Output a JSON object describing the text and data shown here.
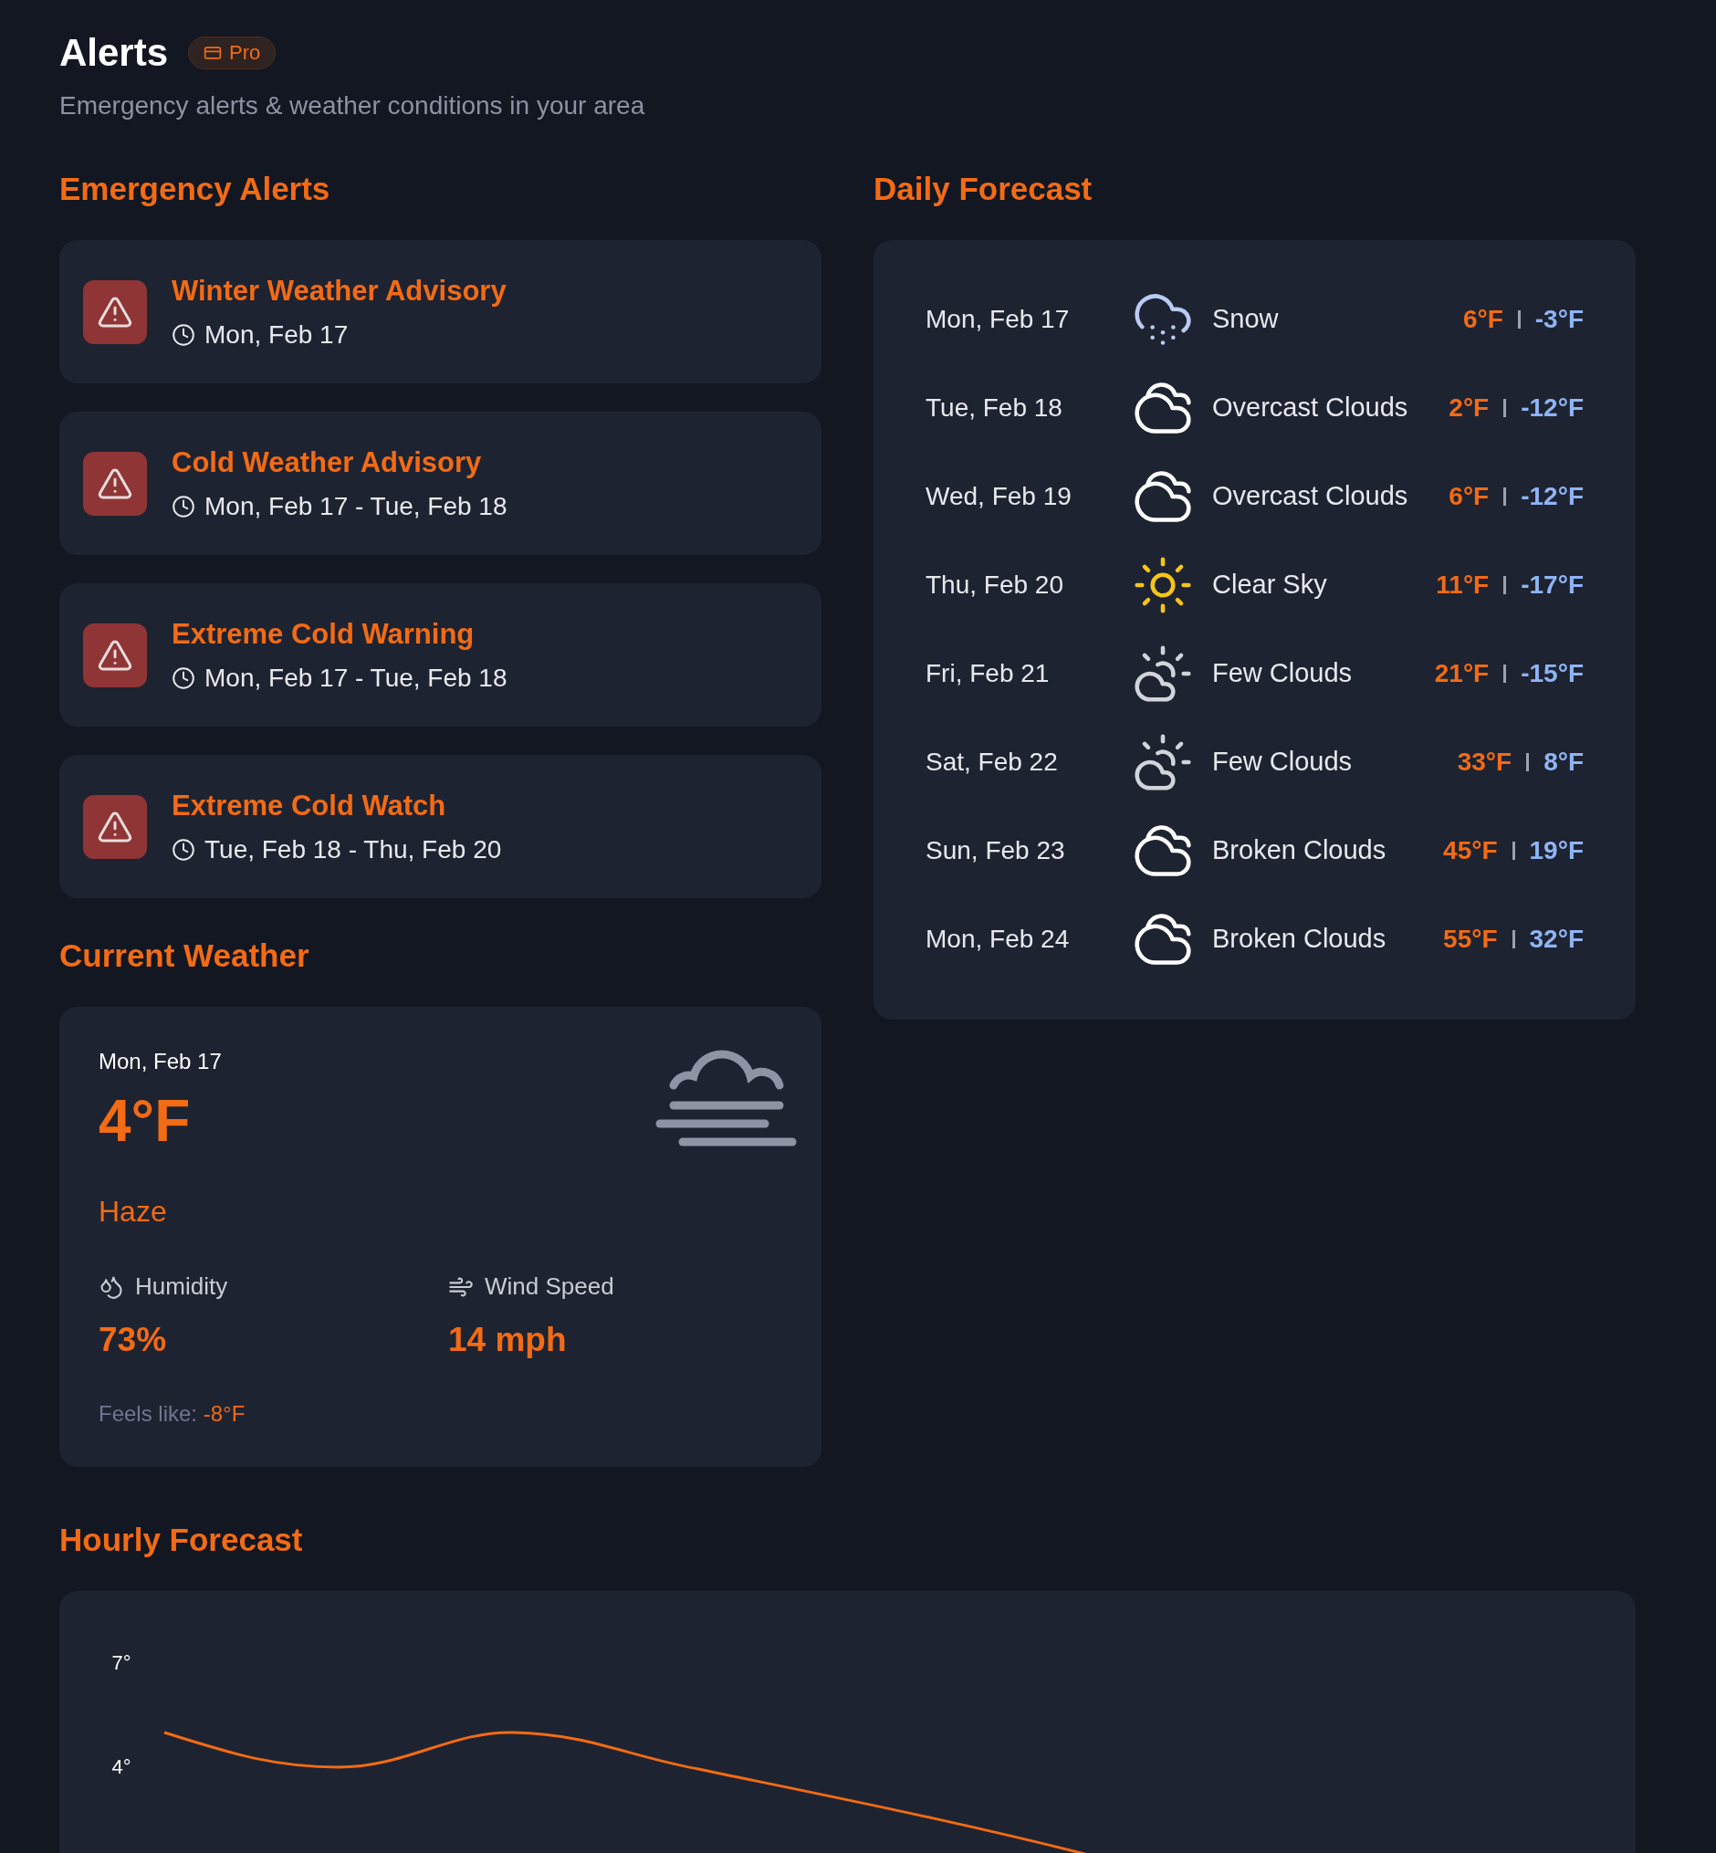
{
  "header": {
    "title": "Alerts",
    "badge": "Pro",
    "subtitle": "Emergency alerts & weather conditions in your area"
  },
  "emergency_alerts": {
    "title": "Emergency Alerts",
    "alerts": [
      {
        "title": "Winter Weather Advisory",
        "time": "Mon, Feb 17"
      },
      {
        "title": "Cold Weather Advisory",
        "time": "Mon, Feb 17 - Tue, Feb 18"
      },
      {
        "title": "Extreme Cold Warning",
        "time": "Mon, Feb 17 - Tue, Feb 18"
      },
      {
        "title": "Extreme Cold Watch",
        "time": "Tue, Feb 18 - Thu, Feb 20"
      }
    ]
  },
  "current_weather": {
    "title": "Current Weather",
    "date": "Mon, Feb 17",
    "temperature": "4°F",
    "condition": "Haze",
    "kind": "haze",
    "humidity": {
      "label": "Humidity",
      "value": "73%"
    },
    "wind_speed": {
      "label": "Wind Speed",
      "value": "14 mph"
    },
    "feels_like": {
      "label": "Feels like:",
      "value": "-8°F"
    }
  },
  "daily_forecast": {
    "title": "Daily Forecast",
    "days": [
      {
        "date": "Mon, Feb 17",
        "kind": "snow",
        "description": "Snow",
        "high": "6°F",
        "low": "-3°F"
      },
      {
        "date": "Tue, Feb 18",
        "kind": "clouds",
        "description": "Overcast Clouds",
        "high": "2°F",
        "low": "-12°F"
      },
      {
        "date": "Wed, Feb 19",
        "kind": "clouds",
        "description": "Overcast Clouds",
        "high": "6°F",
        "low": "-12°F"
      },
      {
        "date": "Thu, Feb 20",
        "kind": "clear",
        "description": "Clear Sky",
        "high": "11°F",
        "low": "-17°F"
      },
      {
        "date": "Fri, Feb 21",
        "kind": "few_clouds",
        "description": "Few Clouds",
        "high": "21°F",
        "low": "-15°F"
      },
      {
        "date": "Sat, Feb 22",
        "kind": "few_clouds",
        "description": "Few Clouds",
        "high": "33°F",
        "low": "8°F"
      },
      {
        "date": "Sun, Feb 23",
        "kind": "clouds",
        "description": "Broken Clouds",
        "high": "45°F",
        "low": "19°F"
      },
      {
        "date": "Mon, Feb 24",
        "kind": "clouds",
        "description": "Broken Clouds",
        "high": "55°F",
        "low": "32°F"
      }
    ]
  },
  "hourly_forecast": {
    "title": "Hourly Forecast",
    "axis_labels": [
      "7°",
      "4°"
    ]
  }
}
